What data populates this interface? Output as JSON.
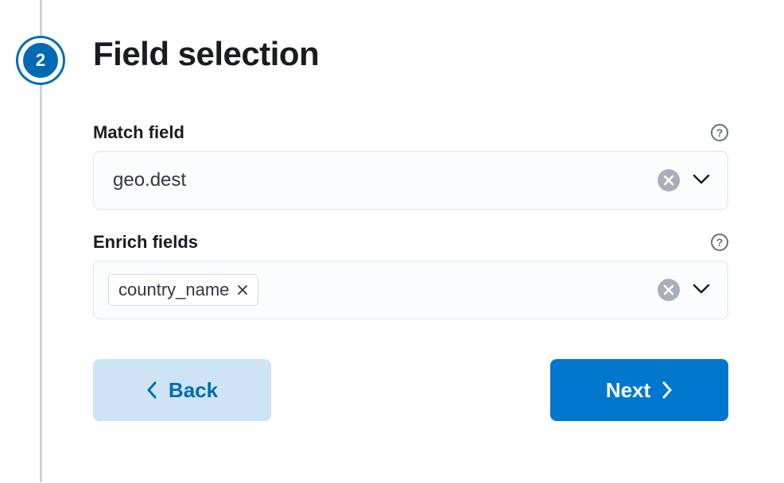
{
  "step": {
    "number": "2"
  },
  "title": "Field selection",
  "matchField": {
    "label": "Match field",
    "value": "geo.dest"
  },
  "enrichFields": {
    "label": "Enrich fields",
    "chips": [
      "country_name"
    ]
  },
  "buttons": {
    "back": "Back",
    "next": "Next"
  }
}
